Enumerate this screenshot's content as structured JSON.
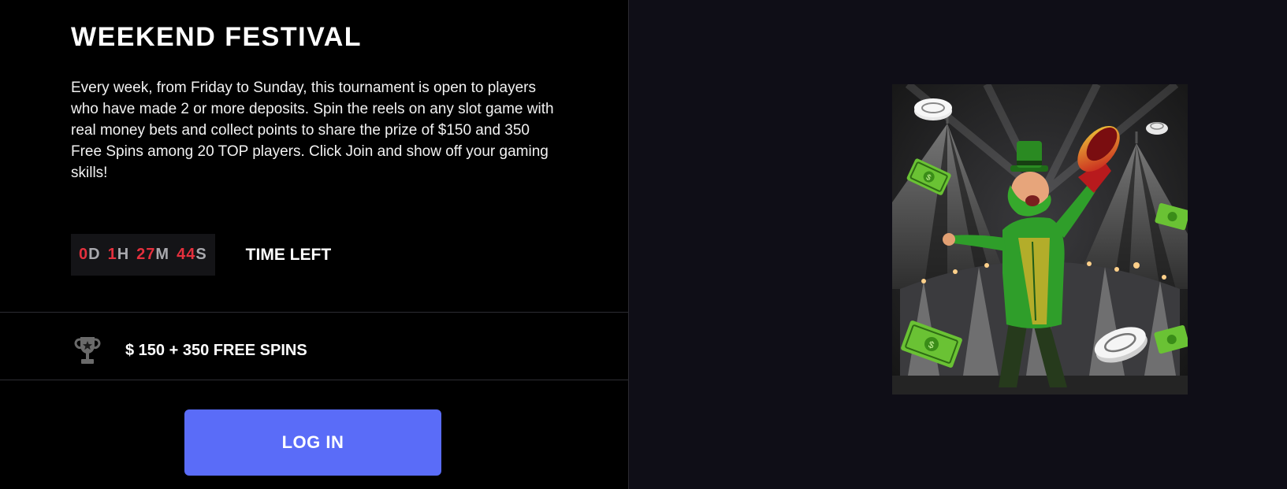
{
  "tournament": {
    "title": "WEEKEND FESTIVAL",
    "description": "Every week, from Friday to Sunday, this tournament is open to players who have made 2 or more deposits. Spin the reels on any slot game with real money bets and collect points to share the prize of $150 and 350 Free Spins among 20 TOP players. Click Join and show off your gaming skills!"
  },
  "timer": {
    "days": "0",
    "days_unit": "D",
    "hours": "1",
    "hours_unit": "H",
    "minutes": "27",
    "minutes_unit": "M",
    "seconds": "44",
    "seconds_unit": "S",
    "label": "TIME LEFT"
  },
  "prize": {
    "icon": "trophy-icon",
    "text": "$ 150 + 350 FREE SPINS"
  },
  "actions": {
    "login_label": "LOG IN"
  },
  "colors": {
    "accent_red": "#e4303d",
    "button_blue": "#5a6cf8",
    "panel_dark": "#0f0e17",
    "character_green": "#2f9e2a"
  }
}
